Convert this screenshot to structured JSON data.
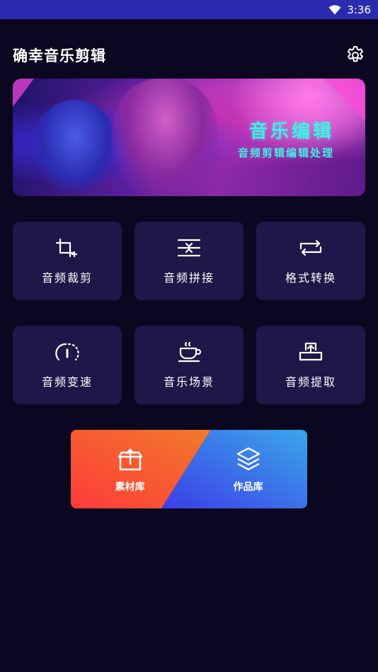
{
  "status_bar": {
    "time": "3:36",
    "wifi_icon": "wifi-icon"
  },
  "header": {
    "title": "确幸音乐剪辑",
    "settings_icon": "gear-icon"
  },
  "banner": {
    "title": "音乐编辑",
    "subtitle": "音频剪辑编辑处理"
  },
  "tools": [
    {
      "label": "音频裁剪",
      "icon": "crop-icon"
    },
    {
      "label": "音频拼接",
      "icon": "merge-icon"
    },
    {
      "label": "格式转换",
      "icon": "convert-icon"
    },
    {
      "label": "音频变速",
      "icon": "speed-icon"
    },
    {
      "label": "音乐场景",
      "icon": "coffee-cup-icon"
    },
    {
      "label": "音频提取",
      "icon": "extract-icon"
    }
  ],
  "bottom_panel": {
    "left": {
      "label": "素材库",
      "icon": "box-icon"
    },
    "right": {
      "label": "作品库",
      "icon": "layers-icon"
    },
    "colors": {
      "left_start": "#ff3b3b",
      "left_end": "#f07a2a",
      "right_start": "#3d3de8",
      "right_end": "#3aa6ea"
    }
  },
  "colors": {
    "background": "#0b0720",
    "tile": "#1e1747",
    "status_bar": "#2b2bb0",
    "accent": "#3ff0e6"
  }
}
